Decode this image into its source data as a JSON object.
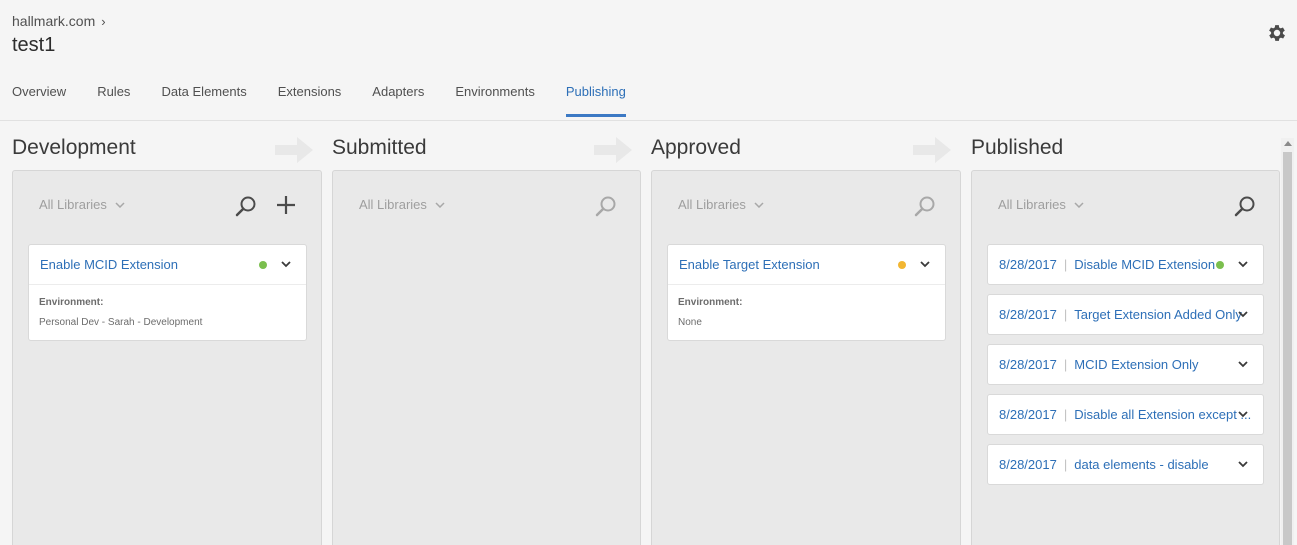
{
  "header": {
    "breadcrumb": "hallmark.com",
    "title": "test1"
  },
  "tabs": [
    {
      "label": "Overview",
      "active": false
    },
    {
      "label": "Rules",
      "active": false
    },
    {
      "label": "Data Elements",
      "active": false
    },
    {
      "label": "Extensions",
      "active": false
    },
    {
      "label": "Adapters",
      "active": false
    },
    {
      "label": "Environments",
      "active": false
    },
    {
      "label": "Publishing",
      "active": true
    }
  ],
  "columns": [
    {
      "title": "Development",
      "filter": "All Libraries",
      "libraries": [
        {
          "name": "Enable MCID Extension",
          "status_color": "#7bbf4e",
          "env_label": "Environment:",
          "env_value": "Personal Dev - Sarah - Development"
        }
      ]
    },
    {
      "title": "Submitted",
      "filter": "All Libraries",
      "libraries": []
    },
    {
      "title": "Approved",
      "filter": "All Libraries",
      "libraries": [
        {
          "name": "Enable Target Extension",
          "status_color": "#f2b632",
          "env_label": "Environment:",
          "env_value": "None"
        }
      ]
    },
    {
      "title": "Published",
      "filter": "All Libraries",
      "libraries": [
        {
          "date": "8/28/2017",
          "name": "Disable MCID Extension",
          "status_color": "#7bbf4e"
        },
        {
          "date": "8/28/2017",
          "name": "Target Extension Added Only"
        },
        {
          "date": "8/28/2017",
          "name": "MCID Extension Only"
        },
        {
          "date": "8/28/2017",
          "name": "Disable all Extension except ..."
        },
        {
          "date": "8/28/2017",
          "name": "data elements - disable"
        }
      ]
    }
  ],
  "colors": {
    "accent": "#2d6fb7",
    "status_green": "#7bbf4e",
    "status_yellow": "#f2b632"
  },
  "icons": {
    "settings": "gear-icon",
    "search": "search-icon",
    "add": "plus-icon",
    "expand": "chevron-down-icon",
    "stage_arrow": "arrow-right-icon"
  }
}
